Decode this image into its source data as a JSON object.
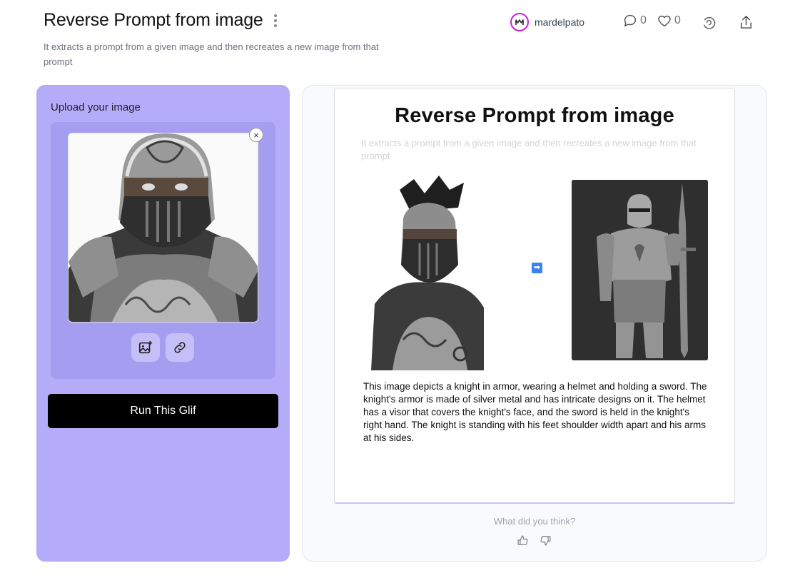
{
  "header": {
    "title": "Reverse Prompt from image",
    "description": "It extracts a prompt from a given image and then recreates a new image from that prompt",
    "author": "mardelpato",
    "comments_count": "0",
    "likes_count": "0"
  },
  "left_panel": {
    "upload_label": "Upload your image",
    "close_symbol": "×",
    "run_button_label": "Run This Glif"
  },
  "result_card": {
    "title": "Reverse Prompt from image",
    "description": "It extracts a prompt from a given image and then recreates a new image from that prompt",
    "arrow_symbol": "➡",
    "generated_text": "This image depicts a knight in armor, wearing a helmet and holding a sword. The knight's armor is made of silver metal and has intricate designs on it. The helmet has a visor that covers the knight's face, and the sword is held in the knight's right hand. The knight is standing with his feet shoulder width apart and his arms at his sides."
  },
  "feedback": {
    "question": "What did you think?"
  },
  "colors": {
    "left_panel_bg": "#b4acf8",
    "upload_box_bg": "#a59df0",
    "run_button_bg": "#000000",
    "avatar_ring": "#c026d3",
    "arrow_badge": "#3b82f6"
  },
  "icons": [
    "kebab-menu-icon",
    "comment-icon",
    "heart-icon",
    "remix-icon",
    "share-icon",
    "close-icon",
    "image-upload-icon",
    "link-icon",
    "arrow-right-icon",
    "thumbs-up-icon",
    "thumbs-down-icon"
  ]
}
